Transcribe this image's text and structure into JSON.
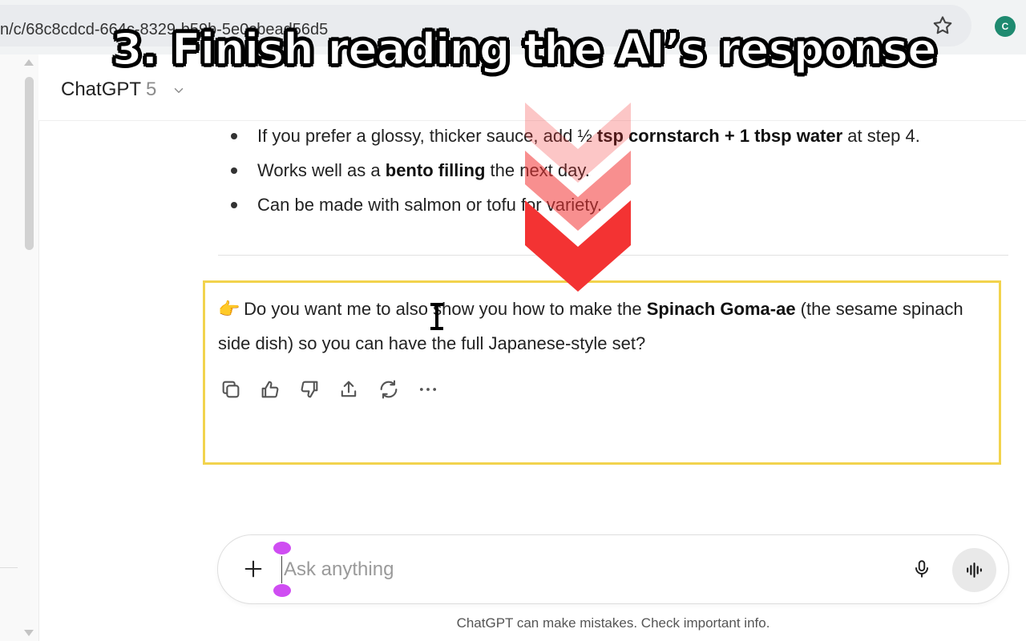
{
  "browser": {
    "url": "n/c/68c8cdcd-664c-8329-b59b-5e0cbead56d5",
    "profile_initials": "C"
  },
  "header": {
    "model_name": "ChatGPT",
    "model_version": "5"
  },
  "response": {
    "bullets": [
      {
        "pre": "If you prefer a glossy, thicker sauce, add ½ ",
        "bold": "tsp cornstarch + 1 tbsp water",
        "post": " at step 4."
      },
      {
        "pre": "Works well as a ",
        "bold": "bento filling",
        "post": " the next day."
      },
      {
        "pre": "Can be made with salmon or tofu for variety.",
        "bold": "",
        "post": ""
      }
    ],
    "followup": {
      "emoji": "👉",
      "pre": " Do you want me to also show you how to make the ",
      "bold": "Spinach Goma-ae",
      "post": " (the sesame spinach side dish) so you can have the full Japanese-style set?"
    },
    "actions": [
      "copy-icon",
      "thumbs-up-icon",
      "thumbs-down-icon",
      "share-icon",
      "regenerate-icon",
      "more-icon"
    ]
  },
  "composer": {
    "placeholder": "Ask anything"
  },
  "footer": {
    "disclaimer": "ChatGPT can make mistakes. Check important info."
  },
  "overlay": {
    "title": "3. Finish reading the AI’s response",
    "highlight_color": "#f2d34d",
    "arrow_color": "#f33333"
  }
}
